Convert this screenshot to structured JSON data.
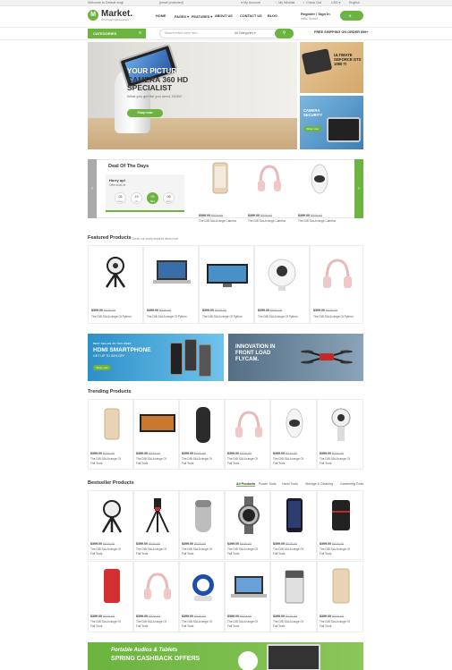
{
  "topbar": {
    "welcome": "Welcome to Default msg!",
    "email": "[email protected]",
    "account": "My Account",
    "wishlist": "My Wishlist",
    "checkout": "Check Out",
    "currency": "USD",
    "language": "English"
  },
  "header": {
    "logo_letter": "M",
    "logo": "Market.",
    "logo_sub": "Wholesale Marketplace",
    "nav": [
      "HOME",
      "PAGES",
      "FEATURES",
      "ABOUT US",
      "CONTACT US",
      "BLOG"
    ],
    "register": "Register / Sign In",
    "register_sub": "Hello Guest!",
    "cart": "0"
  },
  "catbar": {
    "categories": "CATEGORIES",
    "menu_icon": "≡",
    "search_placeholder": "Search entire store here...",
    "search_category": "All Categories",
    "free_shipping": "FREE SHIPPING ON ORDER $99+"
  },
  "hero": {
    "line1": "YOUR PICTURE",
    "line2": "CAMERA 360 HD SPECIALIST",
    "line3": "What you get the you need, NOW!",
    "button": "Shop now"
  },
  "side_banners": {
    "top": "ULTIMATE GEFORCE GTX 1080 TI",
    "bottom": "CAMERA SECURITY",
    "bottom_btn": "Shop now"
  },
  "deal": {
    "title": "Deal Of The Days",
    "hurry": "Hurry up!",
    "offer": "Offer ends in:",
    "countdown": [
      {
        "value": "06",
        "unit": "Days"
      },
      {
        "value": "19",
        "unit": "Hrs"
      },
      {
        "value": "05",
        "unit": "Mins"
      },
      {
        "value": "06",
        "unit": "Secs"
      }
    ],
    "products": [
      {
        "price": "$399.00",
        "old": "$525.00",
        "name": "The DIB SALA range Camera"
      },
      {
        "price": "$399.00",
        "old": "$525.00",
        "name": "The DIB SALA range Camera"
      },
      {
        "price": "$399.00",
        "old": "$525.00",
        "name": "The DIB SALA range Camera"
      }
    ]
  },
  "featured": {
    "title": "Featured Products",
    "subtitle": "Check our newly featured items now!",
    "products": [
      {
        "price": "$399.00",
        "old": "$525.00",
        "name": "The DIB SALA range Of Python"
      },
      {
        "price": "$399.00",
        "old": "$525.00",
        "name": "The DIB SALA range Of Python"
      },
      {
        "price": "$399.00",
        "old": "$525.00",
        "name": "The DIB SALA range Of Python"
      },
      {
        "price": "$399.00",
        "old": "$525.00",
        "name": "The DIB SALA range Of Python"
      },
      {
        "price": "$399.00",
        "old": "$525.00",
        "name": "The DIB SALA range Of Python"
      }
    ]
  },
  "banners": {
    "left_small": "BEST SELLER ON THIS WEEK",
    "left_big": "HDMI SMARTPHONE",
    "left_offer": "GET UP TO 50% OFF",
    "left_btn": "Shop now",
    "right": "INNOVATION IN FRONT LOAD FLYCAM."
  },
  "trending": {
    "title": "Trending Products",
    "products": [
      {
        "price": "$399.00",
        "old": "$525.00",
        "name": "The DIB SALA range Of",
        "name2": "Fall Tools"
      },
      {
        "price": "$399.00",
        "old": "$525.00",
        "name": "The DIB SALA range Of",
        "name2": "Fall Tools"
      },
      {
        "price": "$399.00",
        "old": "$525.00",
        "name": "The DIB SALA range Of",
        "name2": "Fall Tools"
      },
      {
        "price": "$399.00",
        "old": "$525.00",
        "name": "The DIB SALA range Of",
        "name2": "Fall Tools"
      },
      {
        "price": "$399.00",
        "old": "$525.00",
        "name": "The DIB SALA range Of",
        "name2": "Fall Tools"
      },
      {
        "price": "$399.00",
        "old": "$525.00",
        "name": "The DIB SALA range Of",
        "name2": "Fall Tools"
      }
    ]
  },
  "bestseller": {
    "title": "Bestseller Products",
    "tabs": [
      "All Products",
      "Power Tools",
      "Hand Tools",
      "Storage & Cleaning",
      "Gardening Tools"
    ],
    "products": [
      {
        "price": "$399.00",
        "old": "$525.00",
        "name": "The DIB SALA range Of",
        "name2": "Fall Tools"
      },
      {
        "price": "$399.00",
        "old": "$525.00",
        "name": "The DIB SALA range Of",
        "name2": "Fall Tools"
      },
      {
        "price": "$399.00",
        "old": "$525.00",
        "name": "The DIB SALA range Of",
        "name2": "Fall Tools"
      },
      {
        "price": "$399.00",
        "old": "$525.00",
        "name": "The DIB SALA range Of",
        "name2": "Fall Tools"
      },
      {
        "price": "$399.00",
        "old": "$525.00",
        "name": "The DIB SALA range Of",
        "name2": "Fall Tools"
      },
      {
        "price": "$399.00",
        "old": "$525.00",
        "name": "The DIB SALA range Of",
        "name2": "Fall Tools"
      },
      {
        "price": "$399.00",
        "old": "$525.00",
        "name": "The DIB SALA range Of",
        "name2": "Fall Tools"
      },
      {
        "price": "$399.00",
        "old": "$525.00",
        "name": "The DIB SALA range Of",
        "name2": "Fall Tools"
      },
      {
        "price": "$399.00",
        "old": "$525.00",
        "name": "The DIB SALA range Of",
        "name2": "Fall Tools"
      },
      {
        "price": "$399.00",
        "old": "$525.00",
        "name": "The DIB SALA range Of",
        "name2": "Fall Tools"
      },
      {
        "price": "$399.00",
        "old": "$525.00",
        "name": "The DIB SALA range Of",
        "name2": "Fall Tools"
      },
      {
        "price": "$399.00",
        "old": "$525.00",
        "name": "The DIB SALA range Of",
        "name2": "Fall Tools"
      }
    ]
  },
  "bottom_banner": {
    "line1": "Portable Audios & Tablets",
    "line2": "SPRING CASHBACK OFFERS"
  },
  "colors": {
    "accent": "#6cb33f"
  }
}
